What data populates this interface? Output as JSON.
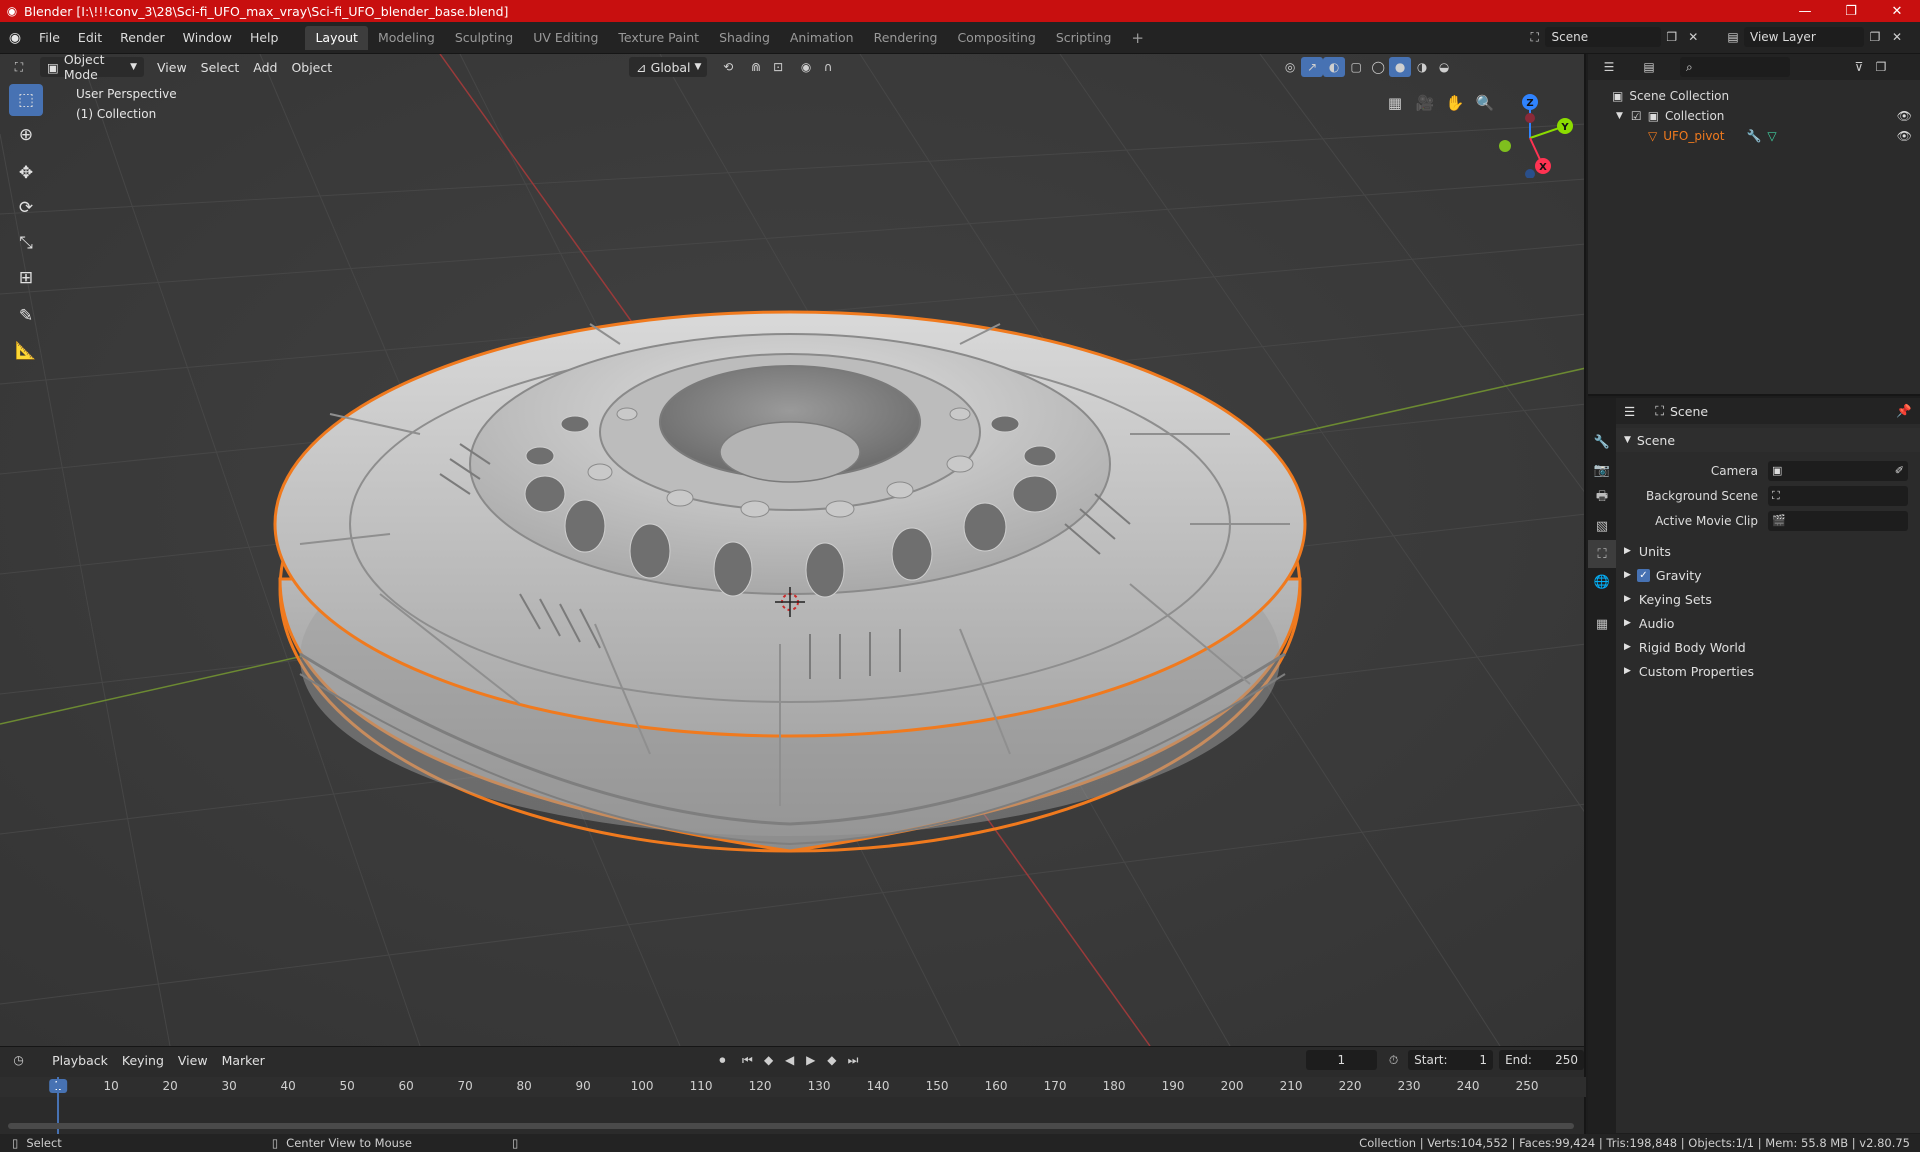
{
  "titlebar": {
    "title": "Blender [I:\\!!!conv_3\\28\\Sci-fi_UFO_max_vray\\Sci-fi_UFO_blender_base.blend]",
    "min": "—",
    "max": "❐",
    "close": "✕"
  },
  "menu": {
    "items": [
      "File",
      "Edit",
      "Render",
      "Window",
      "Help"
    ],
    "workspaces": [
      "Layout",
      "Modeling",
      "Sculpting",
      "UV Editing",
      "Texture Paint",
      "Shading",
      "Animation",
      "Rendering",
      "Compositing",
      "Scripting"
    ],
    "add_tab": "+",
    "scene": "Scene",
    "view_layer": "View Layer"
  },
  "viewport": {
    "mode": "Object Mode",
    "menus": [
      "View",
      "Select",
      "Add",
      "Object"
    ],
    "orientation": "Global",
    "info_line1": "User Perspective",
    "info_line2": "(1) Collection",
    "gizmo_axes": {
      "z": "Z",
      "y": "Y",
      "x": "X"
    },
    "colors": {
      "selection": "#f07a1e",
      "x_axis": "#ff3352",
      "y_axis": "#8bdc00",
      "z_axis": "#2f83ff"
    }
  },
  "outliner": {
    "search_placeholder": "",
    "scene_collection": "Scene Collection",
    "collection": "Collection",
    "object": "UFO_pivot"
  },
  "properties": {
    "header": "Scene",
    "section": "Scene",
    "camera_label": "Camera",
    "background_label": "Background Scene",
    "clip_label": "Active Movie Clip",
    "panels": [
      "Units",
      "Gravity",
      "Keying Sets",
      "Audio",
      "Rigid Body World",
      "Custom Properties"
    ]
  },
  "timeline": {
    "menus": [
      "Playback",
      "Keying",
      "View",
      "Marker"
    ],
    "current_frame": "1",
    "start_label": "Start:",
    "start": "1",
    "end_label": "End:",
    "end": "250",
    "ticks": [
      "1",
      "10",
      "20",
      "30",
      "40",
      "50",
      "60",
      "70",
      "80",
      "90",
      "100",
      "110",
      "120",
      "130",
      "140",
      "150",
      "160",
      "170",
      "180",
      "190",
      "200",
      "210",
      "220",
      "230",
      "240",
      "250"
    ]
  },
  "status": {
    "select": "Select",
    "center": "Center View to Mouse",
    "stats": "Collection | Verts:104,552 | Faces:99,424 | Tris:198,848 | Objects:1/1 | Mem: 55.8 MB | v2.80.75"
  }
}
